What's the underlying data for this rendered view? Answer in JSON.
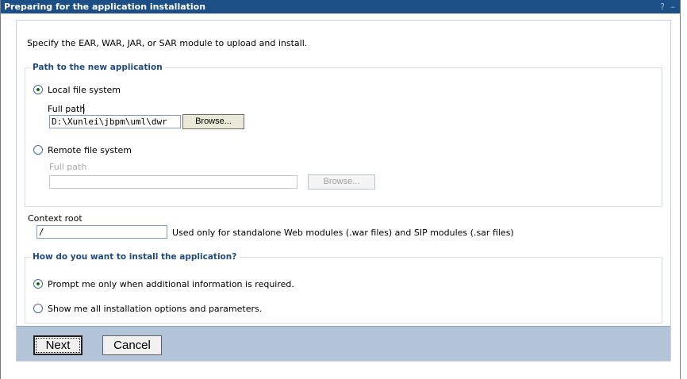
{
  "window": {
    "title": "Preparing for the application installation",
    "help_glyph": "?",
    "minimize_glyph": "–"
  },
  "intro_text": "Specify the EAR, WAR, JAR, or SAR module to upload and install.",
  "path_section": {
    "legend": "Path to the new application",
    "local": {
      "label": "Local file system",
      "selected": true,
      "full_path_label": "Full path",
      "full_path_value": "D:\\Xunlei\\jbpm\\uml\\dwr",
      "browse_label": "Browse..."
    },
    "remote": {
      "label": "Remote file system",
      "selected": false,
      "full_path_label": "Full path",
      "full_path_value": "",
      "browse_label": "Browse..."
    }
  },
  "context_root": {
    "label": "Context root",
    "value": "/",
    "hint": "Used only for standalone Web modules (.war files) and SIP modules (.sar files)"
  },
  "install_section": {
    "legend": "How do you want to install the application?",
    "options": [
      {
        "label": "Prompt me only when additional information is required.",
        "selected": true
      },
      {
        "label": "Show me all installation options and parameters.",
        "selected": false
      }
    ]
  },
  "footer": {
    "next_label": "Next",
    "cancel_label": "Cancel"
  },
  "colors": {
    "titlebar": "#1b4f86",
    "legend_text": "#1e4a7e",
    "footer_bar": "#b3c4d9"
  }
}
